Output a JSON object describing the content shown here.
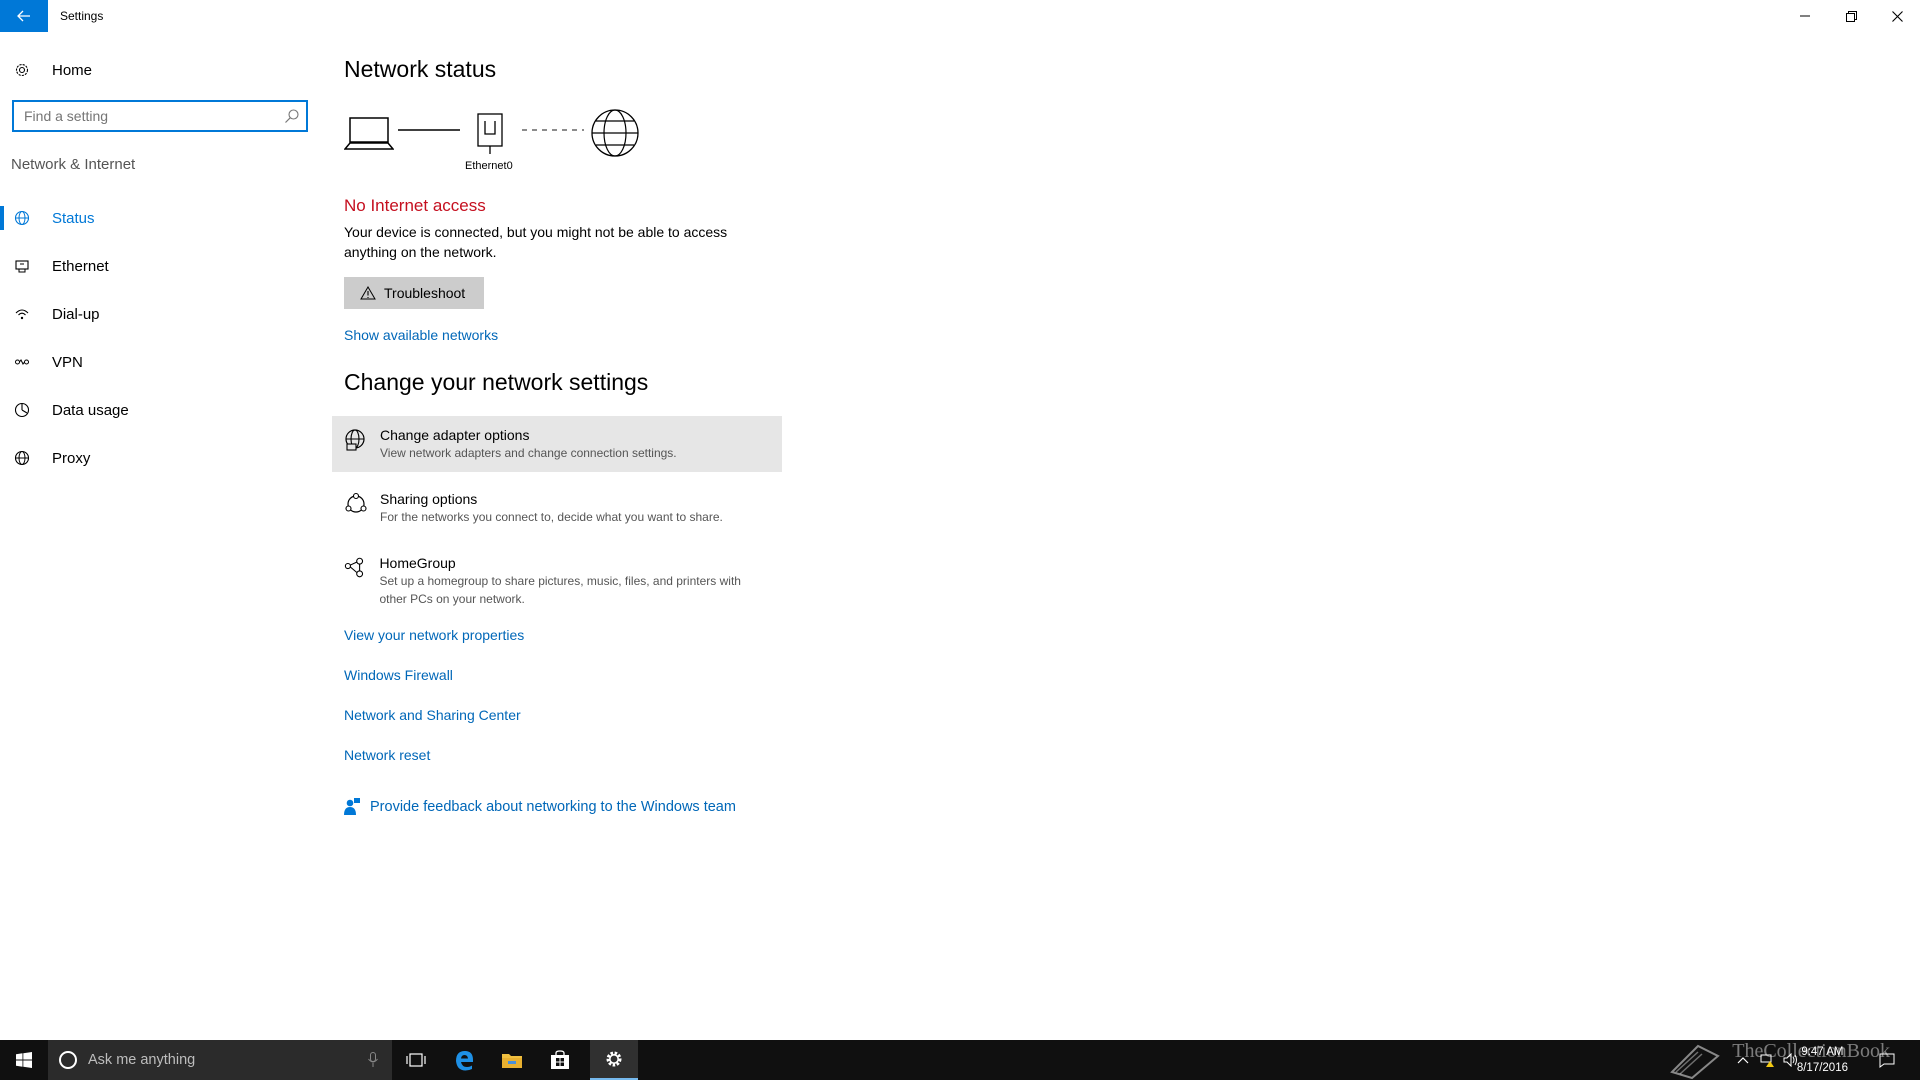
{
  "window": {
    "title": "Settings"
  },
  "sidebar": {
    "home_label": "Home",
    "search_placeholder": "Find a setting",
    "section_title": "Network & Internet",
    "items": [
      {
        "label": "Status",
        "icon": "globe-status-icon",
        "active": true
      },
      {
        "label": "Ethernet",
        "icon": "ethernet-icon"
      },
      {
        "label": "Dial-up",
        "icon": "dialup-icon"
      },
      {
        "label": "VPN",
        "icon": "vpn-icon"
      },
      {
        "label": "Data usage",
        "icon": "data-usage-icon"
      },
      {
        "label": "Proxy",
        "icon": "proxy-globe-icon"
      }
    ]
  },
  "main": {
    "network_status_heading": "Network status",
    "adapter_name": "Ethernet0",
    "status_title": "No Internet access",
    "status_desc": "Your device is connected, but you might not be able to access anything on the network.",
    "troubleshoot_label": "Troubleshoot",
    "show_networks_link": "Show available networks",
    "change_heading": "Change your network settings",
    "options": [
      {
        "title": "Change adapter options",
        "desc": "View network adapters and change connection settings."
      },
      {
        "title": "Sharing options",
        "desc": "For the networks you connect to, decide what you want to share."
      },
      {
        "title": "HomeGroup",
        "desc": "Set up a homegroup to share pictures, music, files, and printers with other PCs on your network."
      }
    ],
    "links": [
      "View your network properties",
      "Windows Firewall",
      "Network and Sharing Center",
      "Network reset"
    ],
    "feedback_label": "Provide feedback about networking to the Windows team"
  },
  "taskbar": {
    "search_placeholder": "Ask me anything",
    "time": "9:47 AM",
    "date": "8/17/2016",
    "watermark": "TheCollectionBook"
  },
  "colors": {
    "accent": "#0078d7",
    "link": "#0067b8",
    "error": "#c50f1f"
  }
}
